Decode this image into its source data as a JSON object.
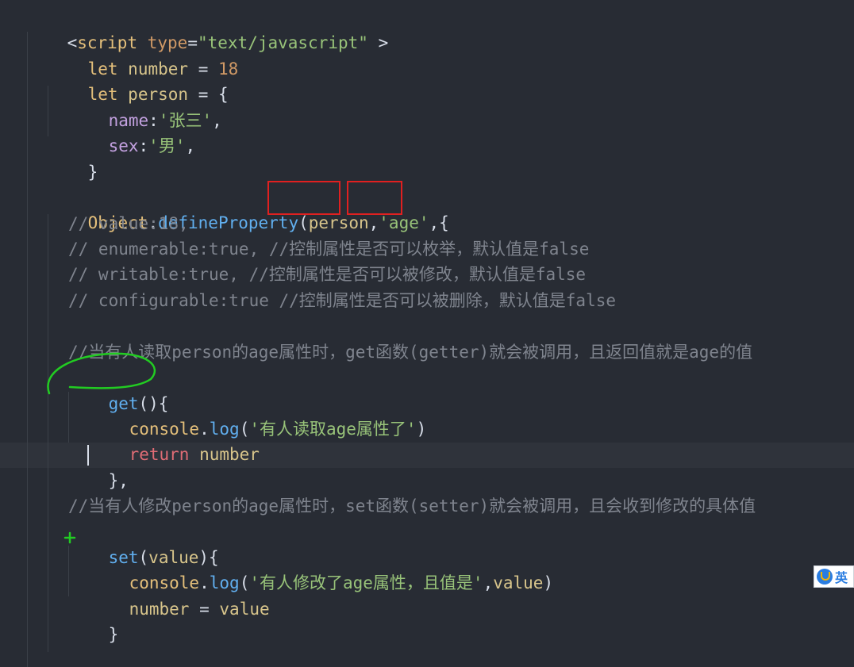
{
  "code": {
    "script_open": {
      "lt": "<",
      "tag": "script",
      "attr": "type",
      "eq": "=",
      "value": "\"text/javascript\"",
      "gt": " >"
    },
    "l_number": {
      "kw": "let",
      "name": "number",
      "op": "=",
      "value": "18"
    },
    "l_person": {
      "kw": "let",
      "name": "person",
      "op": "=",
      "brace": "{"
    },
    "l_name": {
      "key": "name",
      "colon": ":",
      "value": "'张三'",
      "comma": ","
    },
    "l_sex": {
      "key": "sex",
      "colon": ":",
      "value": "'男'",
      "comma": ","
    },
    "l_close1": "}",
    "l_define": {
      "obj": "Object",
      "dot": ".",
      "method": "defineProperty",
      "open": "(",
      "arg1": "person",
      "comma1": ",",
      "arg2": "'age'",
      "comma2": ",",
      "brace": "{"
    },
    "c_value": "// value:18,",
    "c_enum": "// enumerable:true, //控制属性是否可以枚举，默认值是false",
    "c_writable": "// writable:true, //控制属性是否可以被修改，默认值是false",
    "c_config": "// configurable:true //控制属性是否可以被删除，默认值是false",
    "c_get": "//当有人读取person的age属性时，get函数(getter)就会被调用，且返回值就是age的值",
    "l_get": {
      "name": "get",
      "paren": "(){"
    },
    "l_log1": {
      "obj": "console",
      "dot": ".",
      "method": "log",
      "open": "(",
      "str": "'有人读取age属性了'",
      "close": ")"
    },
    "l_return": {
      "kw": "return",
      "value": "number"
    },
    "l_close_get": "},",
    "c_set": "//当有人修改person的age属性时，set函数(setter)就会被调用，且会收到修改的具体值",
    "l_set": {
      "name": "set",
      "open": "(",
      "param": "value",
      "close": "){"
    },
    "l_log2": {
      "obj": "console",
      "dot": ".",
      "method": "log",
      "open": "(",
      "str": "'有人修改了age属性，且值是'",
      "comma": ",",
      "arg": "value",
      "close": ")"
    },
    "l_assign": {
      "name": "number",
      "op": "=",
      "value": "value"
    },
    "l_close_set": "}",
    "l_close_define": "})"
  },
  "ime_badge": {
    "label": "英"
  },
  "colors": {
    "background": "#282c34",
    "keyword": "#e5c07b",
    "function": "#61afef",
    "string": "#98c379",
    "comment": "#7f848e",
    "highlight_box": "#e02020",
    "annotation_stroke": "#22cc22"
  }
}
